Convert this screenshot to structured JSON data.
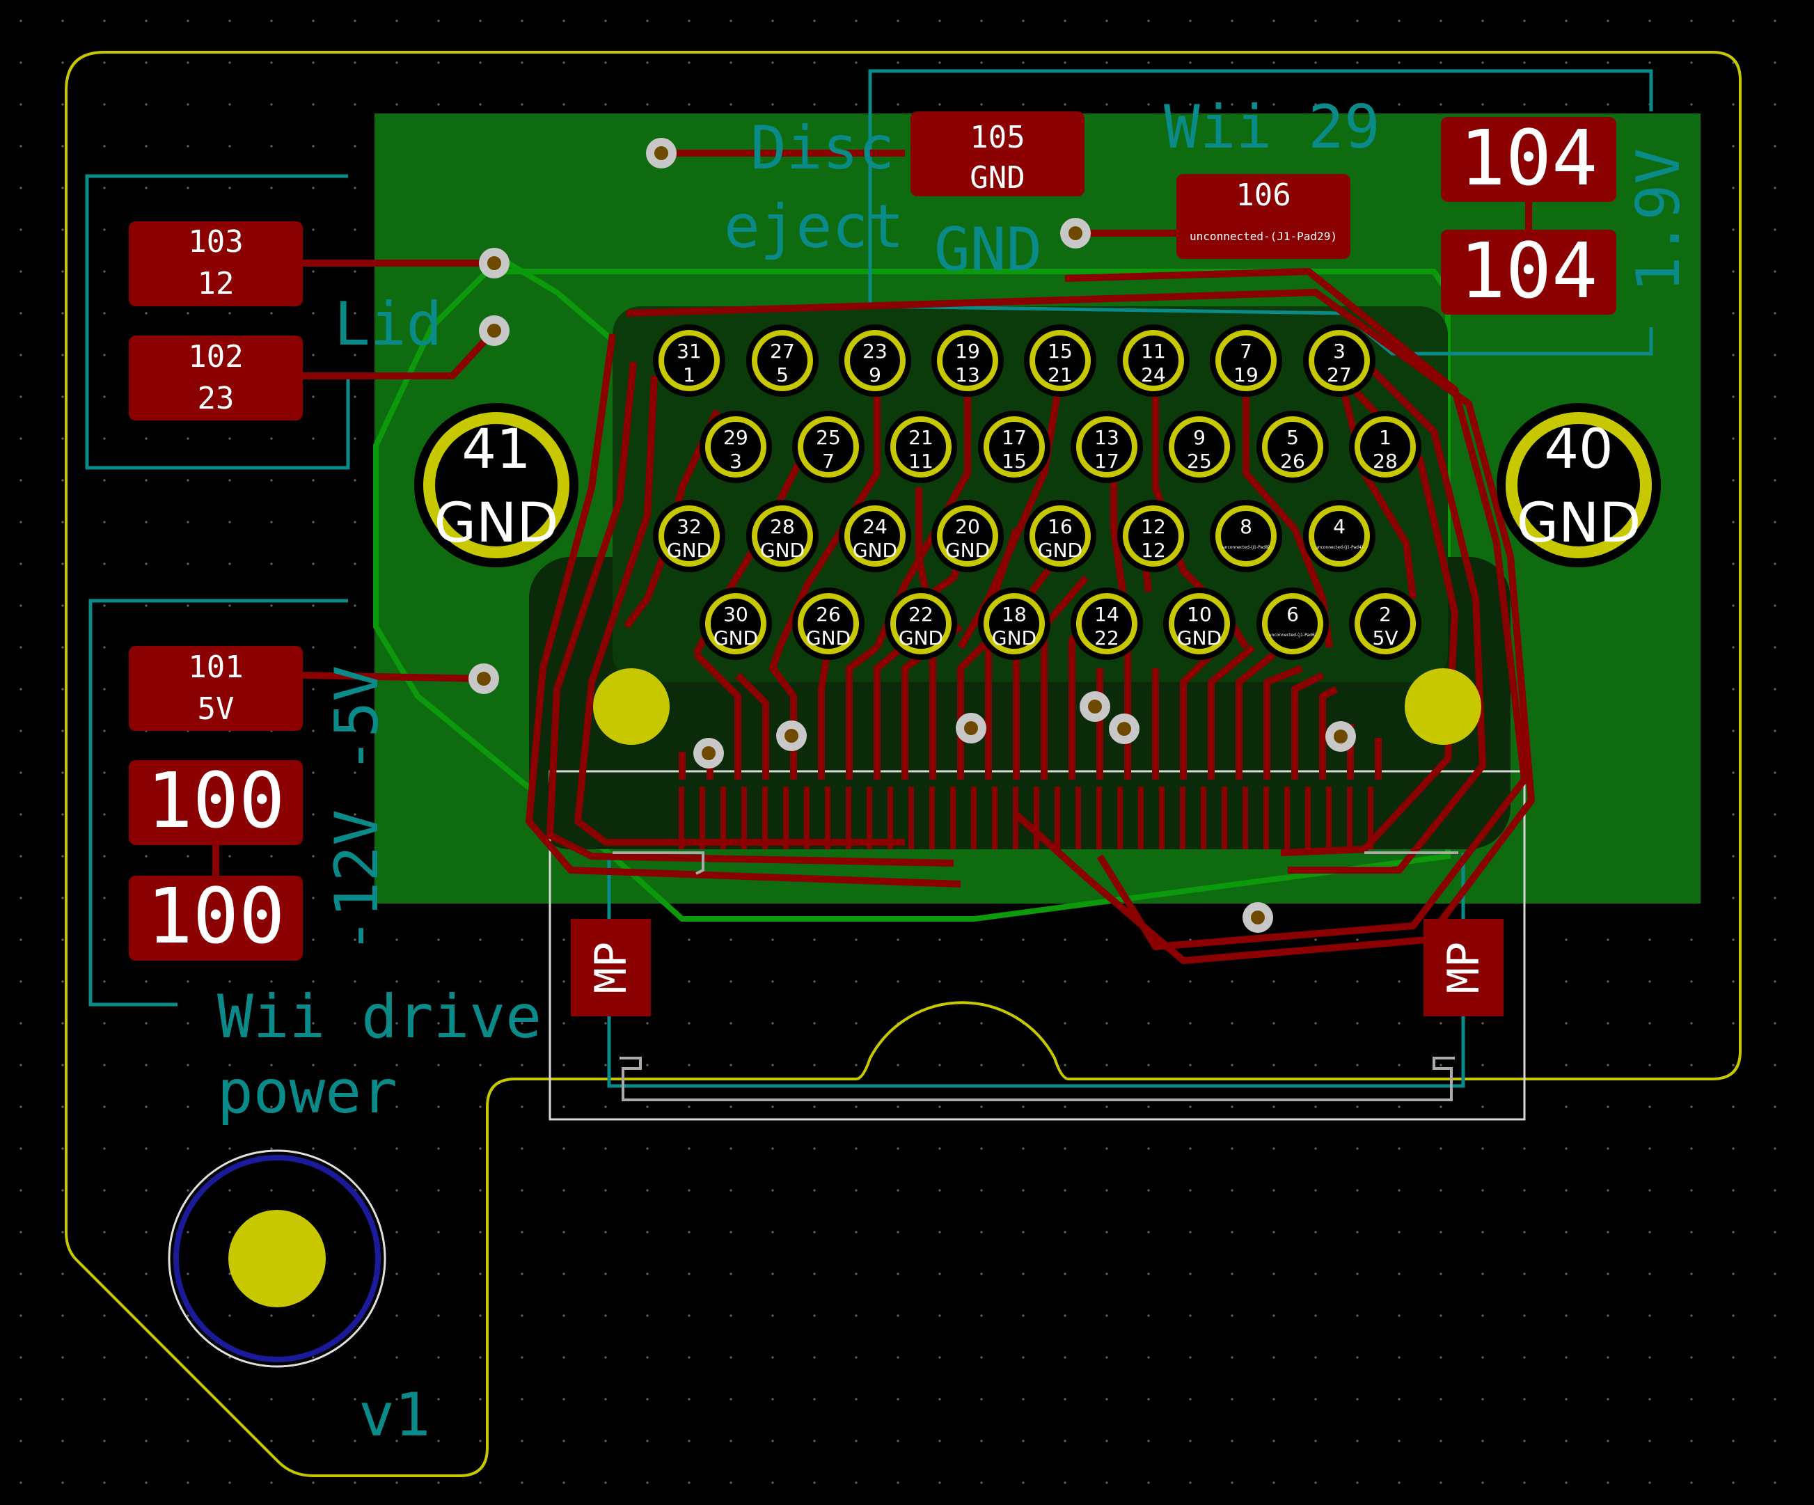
{
  "labels": {
    "disc_eject_line1": "Disc",
    "disc_eject_line2": "eject",
    "wii29": "Wii 29",
    "gnd_silk": "GND",
    "lid": "Lid",
    "v19": "1.9V",
    "power_rail": "-12V -5V",
    "wii_drive_line1": "Wii drive",
    "wii_drive_line2": "power",
    "version": "v1"
  },
  "pads": {
    "p103": {
      "num": "103",
      "net": "12"
    },
    "p102": {
      "num": "102",
      "net": "23"
    },
    "p101": {
      "num": "101",
      "net": "5V"
    },
    "p100a": "100",
    "p100b": "100",
    "p105": {
      "num": "105",
      "net": "GND"
    },
    "p106": {
      "num": "106",
      "net": "unconnected-(J1-Pad29)"
    },
    "p104a": "104",
    "p104b": "104",
    "mp_left": "MP",
    "mp_right": "MP"
  },
  "mounting": [
    {
      "num": "41",
      "net": "GND"
    },
    {
      "num": "40",
      "net": "GND"
    }
  ],
  "connector_rows": [
    [
      [
        "31",
        "1"
      ],
      [
        "27",
        "5"
      ],
      [
        "23",
        "9"
      ],
      [
        "19",
        "13"
      ],
      [
        "15",
        "21"
      ],
      [
        "11",
        "24"
      ],
      [
        "7",
        "19"
      ],
      [
        "3",
        "27"
      ]
    ],
    [
      [
        "29",
        "3"
      ],
      [
        "25",
        "7"
      ],
      [
        "21",
        "11"
      ],
      [
        "17",
        "15"
      ],
      [
        "13",
        "17"
      ],
      [
        "9",
        "25"
      ],
      [
        "5",
        "26"
      ],
      [
        "1",
        "28"
      ]
    ],
    [
      [
        "32",
        "GND"
      ],
      [
        "28",
        "GND"
      ],
      [
        "24",
        "GND"
      ],
      [
        "20",
        "GND"
      ],
      [
        "16",
        "GND"
      ],
      [
        "12",
        "12"
      ],
      [
        "8",
        "unconnected-(J1-Pad8)"
      ],
      [
        "4",
        "unconnected-(J1-Pad4)"
      ]
    ],
    [
      [
        "30",
        "GND"
      ],
      [
        "26",
        "GND"
      ],
      [
        "22",
        "GND"
      ],
      [
        "18",
        "GND"
      ],
      [
        "14",
        "22"
      ],
      [
        "10",
        "GND"
      ],
      [
        "6",
        "unconnected-(J1-Pad6)"
      ],
      [
        "2",
        "5V"
      ]
    ]
  ],
  "colors": {
    "copper": "#8b0000",
    "fill": "#0f6b10",
    "fill_edge": "#0c9a0c",
    "silk": "#0b8a8a",
    "outline": "#c8c800",
    "pad_ring": "#c8c800"
  }
}
